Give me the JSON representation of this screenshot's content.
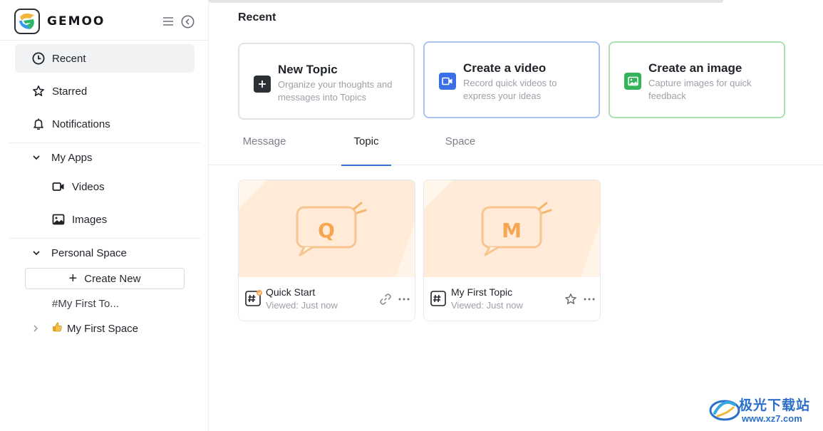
{
  "app": {
    "brand": "GEMOO"
  },
  "sidebar": {
    "nav": [
      {
        "label": "Recent",
        "icon": "clock-icon",
        "active": true
      },
      {
        "label": "Starred",
        "icon": "star-icon"
      },
      {
        "label": "Notifications",
        "icon": "bell-icon"
      }
    ],
    "my_apps": {
      "label": "My Apps",
      "items": [
        {
          "label": "Videos",
          "icon": "video-icon"
        },
        {
          "label": "Images",
          "icon": "image-icon"
        }
      ]
    },
    "personal_space": {
      "label": "Personal Space",
      "create_new": "Create New",
      "topic_link": "#My First To...",
      "space_link": "My First Space"
    }
  },
  "main": {
    "title": "Recent",
    "quick_actions": [
      {
        "title": "New Topic",
        "desc": "Organize your thoughts and messages into Topics",
        "color": "#2b2f36"
      },
      {
        "title": "Create a video",
        "desc": "Record quick videos to express your ideas",
        "color": "#3a6fe8"
      },
      {
        "title": "Create an image",
        "desc": "Capture images for quick feedback",
        "color": "#34b45a"
      }
    ],
    "tabs": [
      {
        "label": "Message",
        "active": false
      },
      {
        "label": "Topic",
        "active": true
      },
      {
        "label": "Space",
        "active": false
      }
    ],
    "topics": [
      {
        "letter": "Q",
        "name": "Quick Start",
        "viewed": "Viewed: Just now"
      },
      {
        "letter": "M",
        "name": "My First Topic",
        "viewed": "Viewed: Just now"
      }
    ]
  },
  "watermark": {
    "text": "极光下载站",
    "url": "www.xz7.com"
  },
  "colors": {
    "accent": "#3a6fd8",
    "thumb_bg": "#fff4e8",
    "thumb_shape": "#ffe9d3",
    "bubble": "#f6b56d"
  }
}
